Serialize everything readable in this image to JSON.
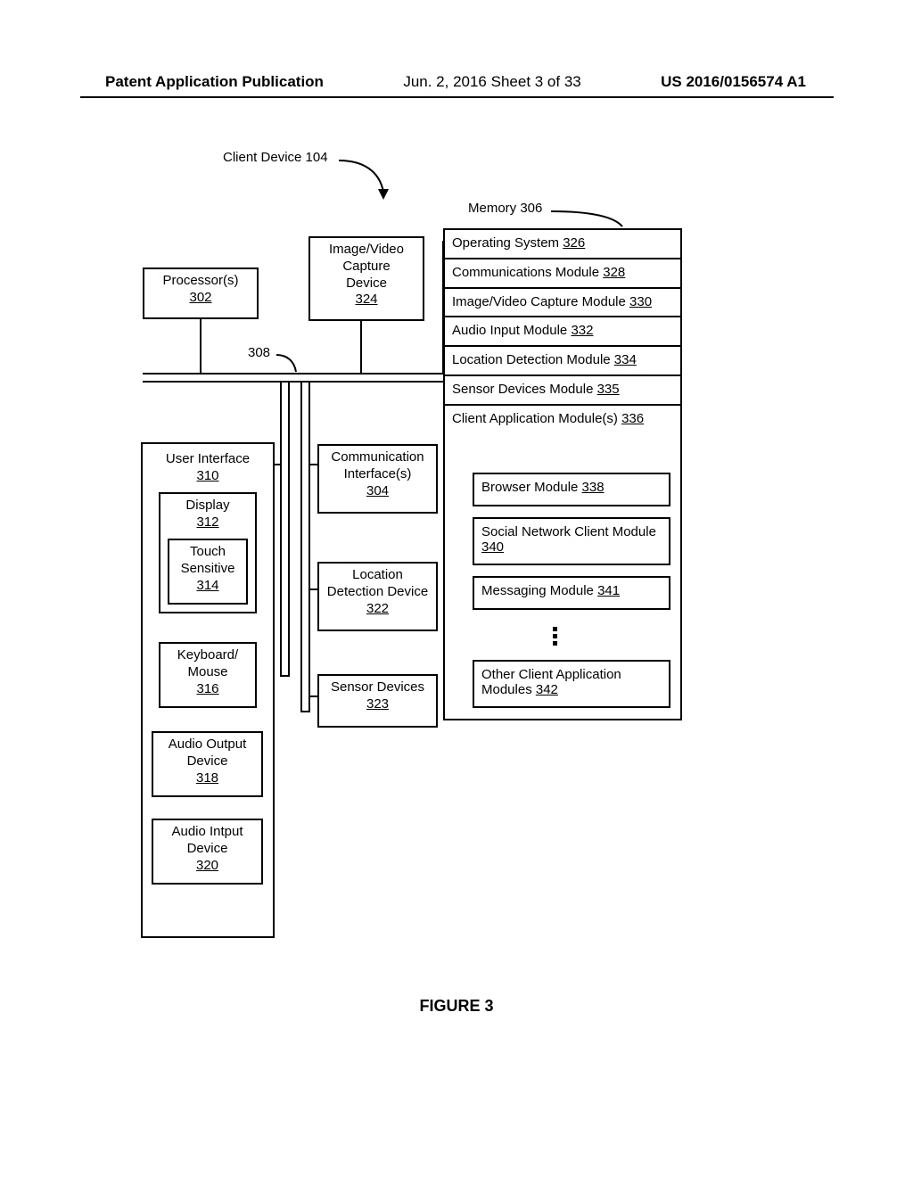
{
  "header": {
    "left": "Patent Application Publication",
    "center": "Jun. 2, 2016  Sheet 3 of 33",
    "right": "US 2016/0156574 A1"
  },
  "labels": {
    "client_device": "Client Device 104",
    "bus_ref": "308",
    "memory": "Memory 306"
  },
  "processor": {
    "title": "Processor(s)",
    "num": "302"
  },
  "capture": {
    "title1": "Image/Video",
    "title2": "Capture",
    "title3": "Device",
    "num": "324"
  },
  "ui": {
    "title": "User Interface",
    "num": "310"
  },
  "display": {
    "title": "Display",
    "num": "312"
  },
  "touch": {
    "title1": "Touch",
    "title2": "Sensitive",
    "num": "314"
  },
  "kbm": {
    "title1": "Keyboard/",
    "title2": "Mouse",
    "num": "316"
  },
  "audout": {
    "title1": "Audio Output",
    "title2": "Device",
    "num": "318"
  },
  "audin": {
    "title1": "Audio Intput",
    "title2": "Device",
    "num": "320"
  },
  "comm": {
    "title1": "Communication",
    "title2": "Interface(s)",
    "num": "304"
  },
  "loc": {
    "title1": "Location",
    "title2": "Detection Device",
    "num": "322"
  },
  "sensor": {
    "title": "Sensor Devices",
    "num": "323"
  },
  "memory_rows": {
    "os": {
      "text": "Operating System ",
      "num": "326"
    },
    "cm": {
      "text": "Communications Module ",
      "num": "328"
    },
    "ivcm": {
      "text": "Image/Video Capture Module ",
      "num": "330"
    },
    "aim": {
      "text": "Audio Input Module ",
      "num": "332"
    },
    "ldm": {
      "text": "Location Detection Module ",
      "num": "334"
    },
    "sdm": {
      "text": "Sensor Devices Module ",
      "num": "335"
    },
    "cam": {
      "text": "Client Application Module(s) ",
      "num": "336"
    }
  },
  "submods": {
    "browser": {
      "text": "Browser Module ",
      "num": "338"
    },
    "snc": {
      "text1": "Social Network Client Module",
      "num": "340"
    },
    "msg": {
      "text": "Messaging Module ",
      "num": "341"
    },
    "other": {
      "text1": "Other Client Application",
      "text2": "Modules ",
      "num": "342"
    }
  },
  "figure": "FIGURE 3"
}
